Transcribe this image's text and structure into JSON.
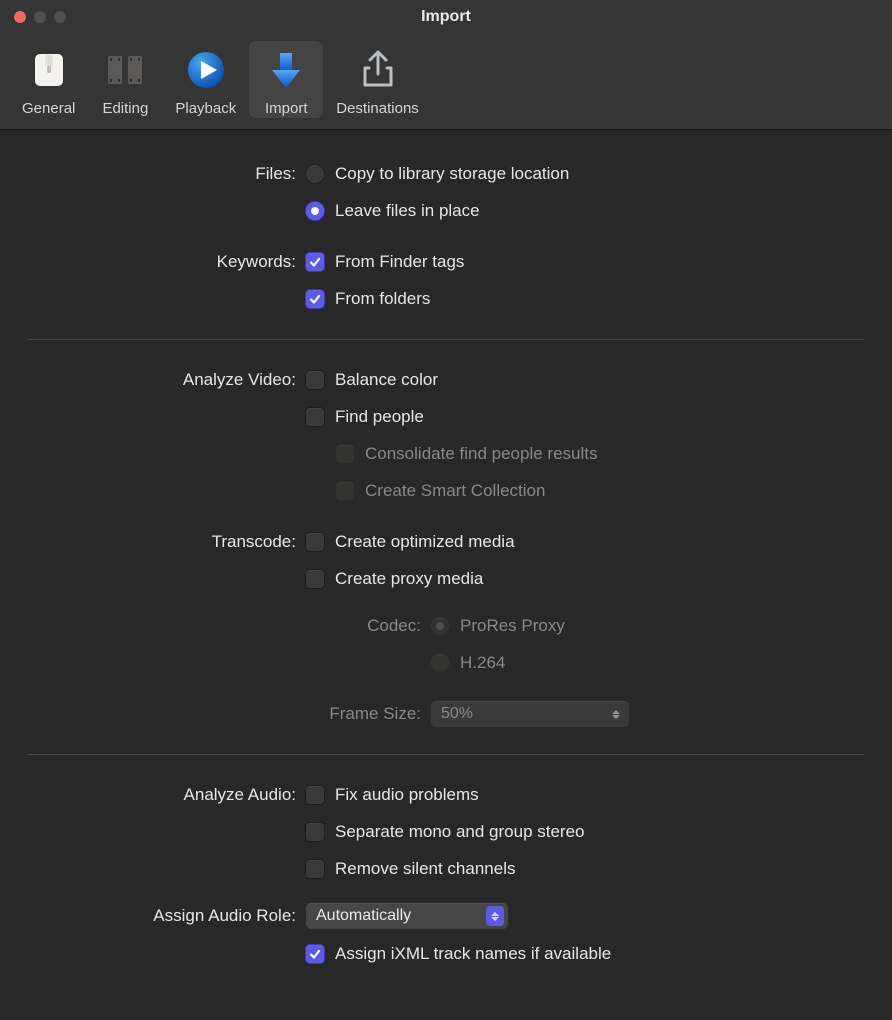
{
  "window": {
    "title": "Import"
  },
  "toolbar": {
    "items": [
      {
        "id": "general",
        "label": "General"
      },
      {
        "id": "editing",
        "label": "Editing"
      },
      {
        "id": "playback",
        "label": "Playback"
      },
      {
        "id": "import",
        "label": "Import"
      },
      {
        "id": "destinations",
        "label": "Destinations"
      }
    ],
    "selected": "import"
  },
  "sections": {
    "files": {
      "label": "Files:",
      "opt_copy": "Copy to library storage location",
      "opt_leave": "Leave files in place"
    },
    "keywords": {
      "label": "Keywords:",
      "opt_tags": "From Finder tags",
      "opt_folders": "From folders"
    },
    "video": {
      "label": "Analyze Video:",
      "opt_balance": "Balance color",
      "opt_find": "Find people",
      "opt_consolidate": "Consolidate find people results",
      "opt_smart": "Create Smart Collection"
    },
    "transcode": {
      "label": "Transcode:",
      "opt_optimized": "Create optimized media",
      "opt_proxy": "Create proxy media",
      "codec_label": "Codec:",
      "codec_prores": "ProRes Proxy",
      "codec_h264": "H.264",
      "framesize_label": "Frame Size:",
      "framesize_value": "50%"
    },
    "audio": {
      "label": "Analyze Audio:",
      "opt_fix": "Fix audio problems",
      "opt_separate": "Separate mono and group stereo",
      "opt_silent": "Remove silent channels"
    },
    "role": {
      "label": "Assign Audio Role:",
      "value": "Automatically",
      "opt_ixml": "Assign iXML track names if available"
    }
  }
}
